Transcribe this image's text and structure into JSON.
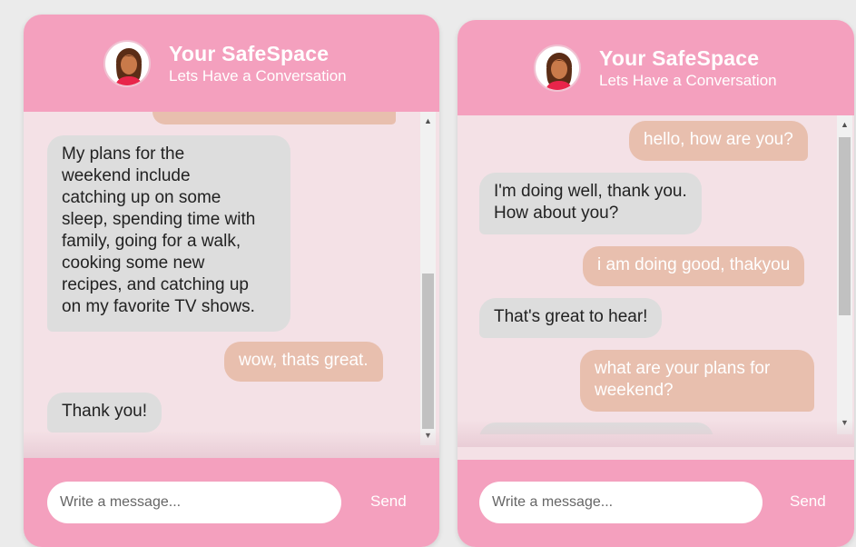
{
  "colors": {
    "header": "#f4a0be",
    "chat_bg": "#f4e1e6",
    "bot_bubble": "#dddddd",
    "user_bubble": "#e8bfae"
  },
  "left": {
    "header": {
      "title": "Your SafeSpace",
      "subtitle": "Lets Have a Conversation",
      "avatar_icon": "woman-avatar-icon"
    },
    "messages": [
      {
        "from": "bot",
        "text": "My plans for the\nweekend include\ncatching up on some\nsleep, spending time with\nfamily, going for a walk,\ncooking some new\nrecipes, and catching up\non my favorite TV shows."
      },
      {
        "from": "user",
        "text": "wow, thats great."
      },
      {
        "from": "bot",
        "text": "Thank you!"
      }
    ],
    "input": {
      "placeholder": "Write a message..."
    },
    "send_label": "Send"
  },
  "right": {
    "header": {
      "title": "Your SafeSpace",
      "subtitle": "Lets Have a Conversation",
      "avatar_icon": "woman-avatar-icon"
    },
    "messages": [
      {
        "from": "user",
        "text": "hello, how are you?"
      },
      {
        "from": "bot",
        "text": "I'm doing well, thank you.\nHow about you?"
      },
      {
        "from": "user",
        "text": "i am doing good, thakyou"
      },
      {
        "from": "bot",
        "text": "That's great to hear!"
      },
      {
        "from": "user",
        "text": "what are your plans for\nweekend?"
      }
    ],
    "input": {
      "placeholder": "Write a message..."
    },
    "send_label": "Send"
  }
}
